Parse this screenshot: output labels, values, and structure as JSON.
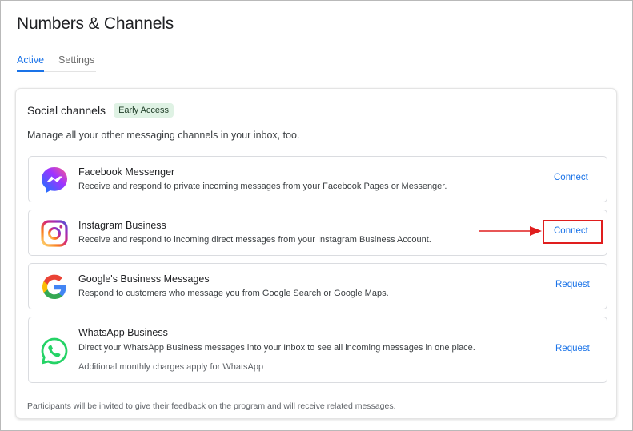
{
  "page": {
    "title": "Numbers & Channels"
  },
  "tabs": [
    {
      "label": "Active",
      "active": true
    },
    {
      "label": "Settings",
      "active": false
    }
  ],
  "social": {
    "title": "Social channels",
    "badge": "Early Access",
    "description": "Manage all your other messaging channels in your inbox, too.",
    "channels": [
      {
        "name": "Facebook Messenger",
        "description": "Receive and respond to private incoming messages from your Facebook Pages or Messenger.",
        "action": "Connect",
        "icon": "facebook-messenger-icon"
      },
      {
        "name": "Instagram Business",
        "description": "Receive and respond to incoming direct messages from your Instagram Business Account.",
        "action": "Connect",
        "icon": "instagram-icon",
        "highlighted": true
      },
      {
        "name": "Google's Business Messages",
        "description": "Respond to customers who message you from Google Search or Google Maps.",
        "action": "Request",
        "icon": "google-icon"
      },
      {
        "name": "WhatsApp Business",
        "description": "Direct your WhatsApp Business messages into your Inbox to see all incoming messages in one place.",
        "note": "Additional monthly charges apply for WhatsApp",
        "action": "Request",
        "icon": "whatsapp-icon"
      }
    ],
    "footer": "Participants will be invited to give their feedback on the program and will receive related messages."
  },
  "colors": {
    "accent": "#1a73e8",
    "badge_bg": "#dff2e4",
    "annotation_red": "#e01e1e"
  }
}
